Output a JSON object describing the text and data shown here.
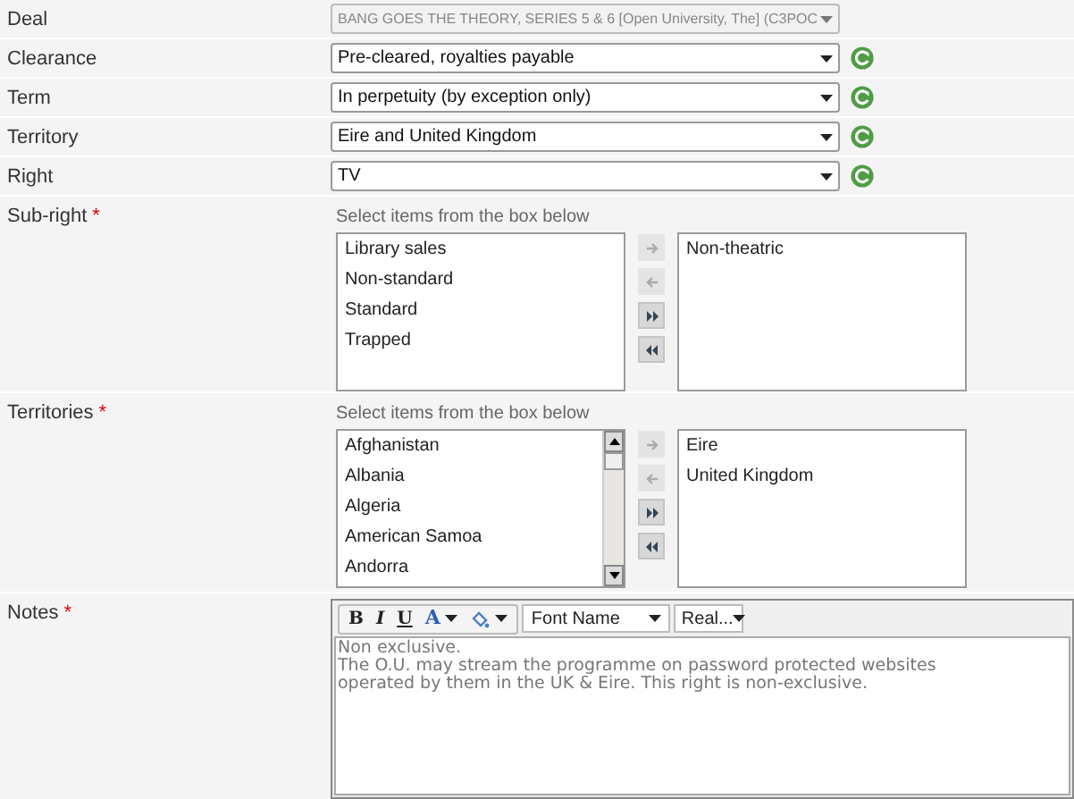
{
  "fields": [
    {
      "label": "Deal",
      "value": "BANG GOES THE THEORY, SERIES 5 & 6 [Open University, The] (C3POC",
      "disabled": true,
      "refresh": false
    },
    {
      "label": "Clearance",
      "value": "Pre-cleared, royalties payable",
      "disabled": false,
      "refresh": true
    },
    {
      "label": "Term",
      "value": "In perpetuity (by exception only)",
      "disabled": false,
      "refresh": true
    },
    {
      "label": "Territory",
      "value": "Eire and  United Kingdom",
      "disabled": false,
      "refresh": true
    },
    {
      "label": "Right",
      "value": "TV",
      "disabled": false,
      "refresh": true
    }
  ],
  "pickers": [
    {
      "label": "Sub-right",
      "required_mark": "*",
      "hint": "Select items from the box below",
      "available": [
        "Library sales",
        "Non-standard",
        "Standard",
        "Trapped"
      ],
      "chosen": [
        "Non-theatric"
      ],
      "scrollbar": false,
      "buttons": [
        {
          "kind": "add",
          "disabled": true
        },
        {
          "kind": "remove",
          "disabled": true
        },
        {
          "kind": "add-all",
          "disabled": false
        },
        {
          "kind": "remove-all",
          "disabled": false
        }
      ]
    },
    {
      "label": "Territories",
      "required_mark": "*",
      "hint": "Select items from the box below",
      "available": [
        "Afghanistan",
        "Albania",
        "Algeria",
        "American Samoa",
        "Andorra"
      ],
      "chosen": [
        "Eire",
        "United Kingdom"
      ],
      "scrollbar": true,
      "buttons": [
        {
          "kind": "add",
          "disabled": true
        },
        {
          "kind": "remove",
          "disabled": true
        },
        {
          "kind": "add-all",
          "disabled": false
        },
        {
          "kind": "remove-all",
          "disabled": false
        }
      ]
    }
  ],
  "notes": {
    "label": "Notes",
    "required_mark": "*",
    "toolbar": {
      "bold": "B",
      "italic": "I",
      "underline": "U",
      "font_color": "A",
      "font_name": "Font Name",
      "font_size": "Real..."
    },
    "paragraphs": [
      "Non exclusive.",
      "The O.U. may stream the programme on password protected websites operated by them in the UK & Eire. This right is non-exclusive."
    ]
  }
}
